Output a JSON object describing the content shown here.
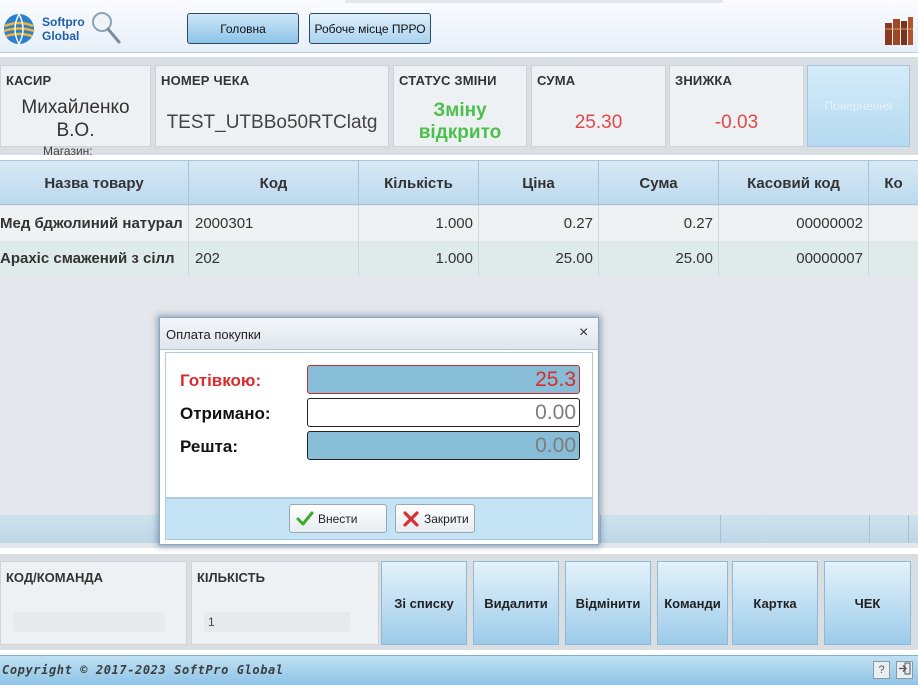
{
  "app": {
    "logo_line1": "Softpro",
    "logo_line2": "Global"
  },
  "nav": {
    "home_label": "Головна",
    "prro_label": "Робоче місце ПРРО"
  },
  "info": {
    "cashier_label": "КАСИР",
    "cashier_name_line1": "Михайленко",
    "cashier_name_line2": "В.О.",
    "shop_label": "Магазин:",
    "check_label": "НОМЕР ЧЕКА",
    "check_number": "TEST_UTBBo50RTClatg",
    "shift_label": "СТАТУС ЗМІНИ",
    "shift_line1": "Зміну",
    "shift_line2": "відкрито",
    "sum_label": "СУМА",
    "sum_value": "25.30",
    "discount_label": "ЗНИЖКА",
    "discount_value": "-0.03",
    "return_label": "Повернення"
  },
  "table": {
    "columns": [
      "Назва товару",
      "Код",
      "Кількість",
      "Ціна",
      "Сума",
      "Касовий код",
      "Ко"
    ],
    "rows": [
      {
        "name": "Мед бджолиний натурал",
        "code": "2000301",
        "qty": "1.000",
        "price": "0.27",
        "sum": "0.27",
        "cash_code": "00000002"
      },
      {
        "name": "Арахіс смажений з сілл",
        "code": "202",
        "qty": "1.000",
        "price": "25.00",
        "sum": "25.00",
        "cash_code": "00000007"
      }
    ]
  },
  "command": {
    "code_label": "КОД/КОМАНДА",
    "code_value": "",
    "qty_label": "КІЛЬКІСТЬ",
    "qty_value": "1",
    "buttons": {
      "from_list": "Зі списку",
      "delete": "Видалити",
      "cancel": "Відмінити",
      "commands": "Команди",
      "card": "Картка",
      "check": "ЧЕК"
    }
  },
  "footer": {
    "copyright": "Copyright © 2017-2023 SoftPro Global",
    "help_icon": "?"
  },
  "dialog": {
    "title": "Оплата покупки",
    "close": "×",
    "cash_label": "Готівкою:",
    "cash_value": "25.3",
    "received_label": "Отримано:",
    "received_value": "0.00",
    "change_label": "Решта:",
    "change_value": "0.00",
    "submit_label": "Внести",
    "close_label": "Закрити"
  },
  "colors": {
    "accent_red": "#d92c2c",
    "status_green": "#4cc04c",
    "header_blue": "#bcd9ee"
  }
}
